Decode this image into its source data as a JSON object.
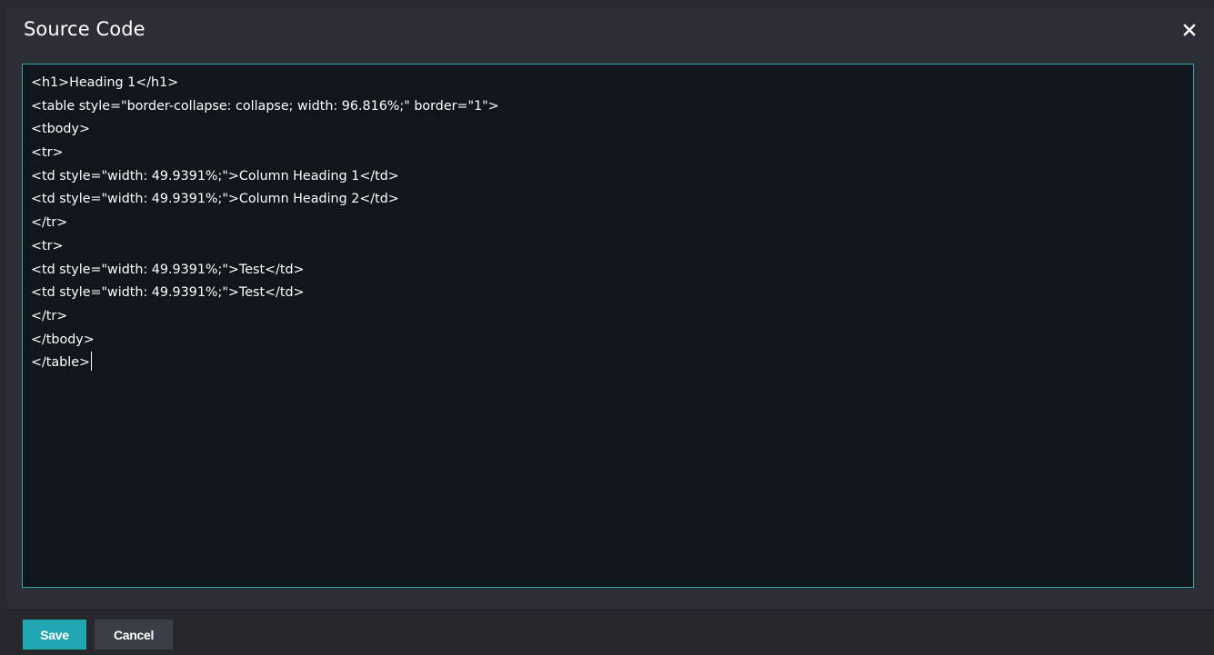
{
  "dialog": {
    "title": "Source Code",
    "close_symbol": "×"
  },
  "editor": {
    "lines": [
      "<h1>Heading 1</h1>",
      "<table style=\"border-collapse: collapse; width: 96.816%;\" border=\"1\">",
      "<tbody>",
      "<tr>",
      "<td style=\"width: 49.9391%;\">Column Heading 1</td>",
      "<td style=\"width: 49.9391%;\">Column Heading 2</td>",
      "</tr>",
      "<tr>",
      "<td style=\"width: 49.9391%;\">Test</td>",
      "<td style=\"width: 49.9391%;\">Test</td>",
      "</tr>",
      "</tbody>",
      "</table>"
    ]
  },
  "footer": {
    "save_label": "Save",
    "cancel_label": "Cancel"
  },
  "colors": {
    "accent": "#21a7b1",
    "editor_border": "#33a9b4",
    "editor_bg": "#11161d",
    "dialog_bg": "#2b2f35"
  },
  "icons": {
    "close": "close-icon"
  }
}
